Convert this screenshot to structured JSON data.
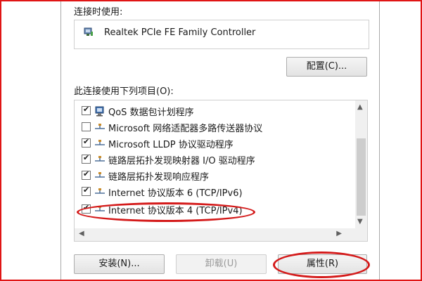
{
  "connect_using": {
    "label": "连接时使用:",
    "adapter": "Realtek PCIe FE Family Controller"
  },
  "buttons": {
    "configure": "配置(C)...",
    "install": "安装(N)...",
    "uninstall": "卸载(U)",
    "properties": "属性(R)"
  },
  "items_label": "此连接使用下列项目(O):",
  "items": [
    {
      "label": "QoS 数据包计划程序",
      "checked": true,
      "icon": "qos-icon"
    },
    {
      "label": "Microsoft 网络适配器多路传送器协议",
      "checked": false,
      "icon": "protocol-icon"
    },
    {
      "label": "Microsoft LLDP 协议驱动程序",
      "checked": true,
      "icon": "protocol-icon"
    },
    {
      "label": "链路层拓扑发现映射器 I/O 驱动程序",
      "checked": true,
      "icon": "protocol-icon"
    },
    {
      "label": "链路层拓扑发现响应程序",
      "checked": true,
      "icon": "protocol-icon"
    },
    {
      "label": "Internet 协议版本 6 (TCP/IPv6)",
      "checked": true,
      "icon": "protocol-icon"
    },
    {
      "label": "Internet 协议版本 4 (TCP/IPv4)",
      "checked": true,
      "icon": "protocol-icon"
    }
  ],
  "colors": {
    "annotation": "#d41a1a"
  }
}
